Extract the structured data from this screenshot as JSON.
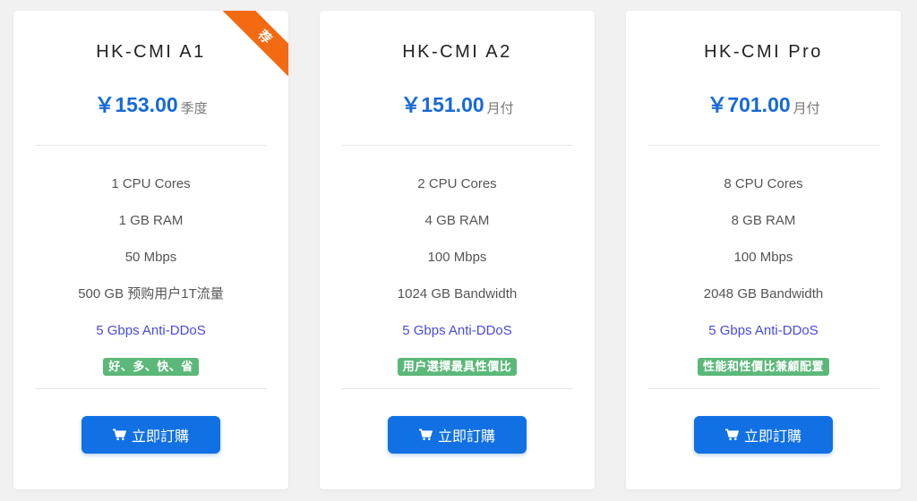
{
  "colors": {
    "price": "#1769d6",
    "ddos": "#4a4ae0",
    "tag_bg": "#5cb87a",
    "button_bg": "#1170e3",
    "ribbon_bg": "#f46a13"
  },
  "icons": {
    "button": "shopping-cart-icon"
  },
  "plans": [
    {
      "name": "HK-CMI A1",
      "price": "￥153.00",
      "period": "季度",
      "ribbon": "荐",
      "features": [
        "1 CPU Cores",
        "1 GB RAM",
        "50 Mbps",
        "500 GB 预购用户1T流量"
      ],
      "ddos": "5 Gbps Anti-DDoS",
      "tag": "好、多、快、省",
      "button": "立即訂購"
    },
    {
      "name": "HK-CMI A2",
      "price": "￥151.00",
      "period": "月付",
      "features": [
        "2 CPU Cores",
        "4 GB RAM",
        "100 Mbps",
        "1024 GB Bandwidth"
      ],
      "ddos": "5 Gbps Anti-DDoS",
      "tag": "用户選擇最具性價比",
      "button": "立即訂購"
    },
    {
      "name": "HK-CMI Pro",
      "price": "￥701.00",
      "period": "月付",
      "features": [
        "8 CPU Cores",
        "8 GB RAM",
        "100 Mbps",
        "2048 GB Bandwidth"
      ],
      "ddos": "5 Gbps Anti-DDoS",
      "tag": "性能和性價比兼顧配置",
      "button": "立即訂購"
    }
  ]
}
